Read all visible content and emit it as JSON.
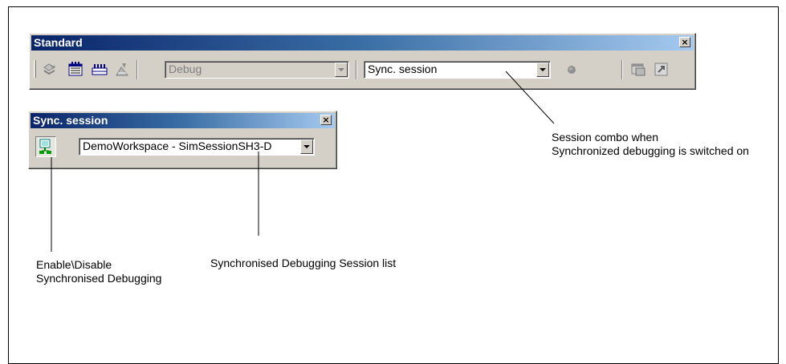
{
  "standard_toolbar": {
    "title": "Standard",
    "close_label": "×",
    "config_combo": {
      "value": "Debug"
    },
    "session_combo": {
      "value": "Sync. session"
    },
    "icons": [
      "step-icon",
      "memory-icon",
      "registers-icon",
      "clear-icon",
      "breakpoint-icon",
      "window-icon",
      "run-icon"
    ]
  },
  "sync_toolbar": {
    "title": "Sync. session",
    "close_label": "×",
    "session_list": {
      "value": "DemoWorkspace - SimSessionSH3-D"
    },
    "icons": [
      "sync-toggle-icon"
    ]
  },
  "annotations": {
    "session_combo_line1": "Session combo when",
    "session_combo_line2": "Synchronized debugging is switched on",
    "session_list": "Synchronised Debugging Session list",
    "enable_line1": "Enable\\Disable",
    "enable_line2": "Synchronised Debugging"
  },
  "colors": {
    "titlebar_start": "#0a246a",
    "titlebar_end": "#a6caf0",
    "face": "#d4d0c8"
  }
}
